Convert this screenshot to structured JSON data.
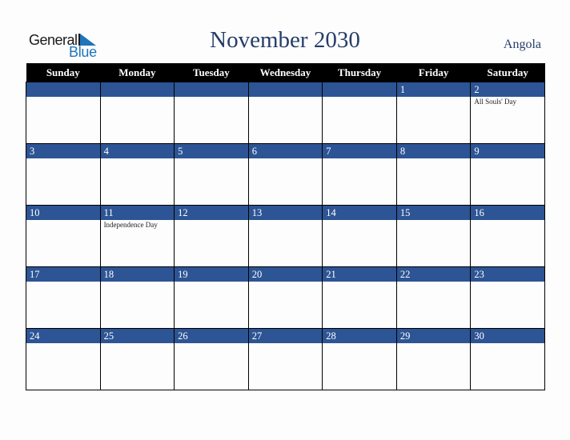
{
  "logo": {
    "word1": "General",
    "word2": "Blue",
    "brand_color": "#1e75bb"
  },
  "header": {
    "title": "November 2030",
    "country": "Angola"
  },
  "colors": {
    "title_color": "#253d6a",
    "header_row_bg": "#000000",
    "day_bar_bg": "#2d5494"
  },
  "weekdays": [
    "Sunday",
    "Monday",
    "Tuesday",
    "Wednesday",
    "Thursday",
    "Friday",
    "Saturday"
  ],
  "weeks": [
    [
      {
        "day": "",
        "holiday": ""
      },
      {
        "day": "",
        "holiday": ""
      },
      {
        "day": "",
        "holiday": ""
      },
      {
        "day": "",
        "holiday": ""
      },
      {
        "day": "",
        "holiday": ""
      },
      {
        "day": "1",
        "holiday": ""
      },
      {
        "day": "2",
        "holiday": "All Souls' Day"
      }
    ],
    [
      {
        "day": "3",
        "holiday": ""
      },
      {
        "day": "4",
        "holiday": ""
      },
      {
        "day": "5",
        "holiday": ""
      },
      {
        "day": "6",
        "holiday": ""
      },
      {
        "day": "7",
        "holiday": ""
      },
      {
        "day": "8",
        "holiday": ""
      },
      {
        "day": "9",
        "holiday": ""
      }
    ],
    [
      {
        "day": "10",
        "holiday": ""
      },
      {
        "day": "11",
        "holiday": "Independence Day"
      },
      {
        "day": "12",
        "holiday": ""
      },
      {
        "day": "13",
        "holiday": ""
      },
      {
        "day": "14",
        "holiday": ""
      },
      {
        "day": "15",
        "holiday": ""
      },
      {
        "day": "16",
        "holiday": ""
      }
    ],
    [
      {
        "day": "17",
        "holiday": ""
      },
      {
        "day": "18",
        "holiday": ""
      },
      {
        "day": "19",
        "holiday": ""
      },
      {
        "day": "20",
        "holiday": ""
      },
      {
        "day": "21",
        "holiday": ""
      },
      {
        "day": "22",
        "holiday": ""
      },
      {
        "day": "23",
        "holiday": ""
      }
    ],
    [
      {
        "day": "24",
        "holiday": ""
      },
      {
        "day": "25",
        "holiday": ""
      },
      {
        "day": "26",
        "holiday": ""
      },
      {
        "day": "27",
        "holiday": ""
      },
      {
        "day": "28",
        "holiday": ""
      },
      {
        "day": "29",
        "holiday": ""
      },
      {
        "day": "30",
        "holiday": ""
      }
    ]
  ]
}
